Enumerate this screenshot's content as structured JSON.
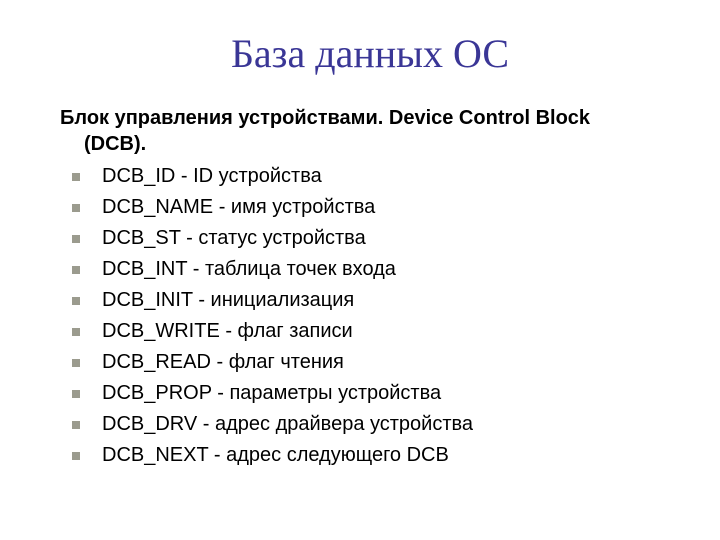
{
  "title": "База данных ОС",
  "heading_line1": "Блок управления устройствами. Device Control Block",
  "heading_line2": "(DCB).",
  "items": [
    "DCB_ID - ID устройства",
    "DCB_NAME - имя устройства",
    "DCB_ST - статус устройства",
    "DCB_INT - таблица точек входа",
    "DCB_INIT - инициализация",
    "DCB_WRITE - флаг записи",
    "DCB_READ - флаг чтения",
    "DCB_PROP - параметры устройства",
    "DCB_DRV - адрес драйвера устройства",
    "DCB_NEXT - адрес следующего DCB"
  ]
}
